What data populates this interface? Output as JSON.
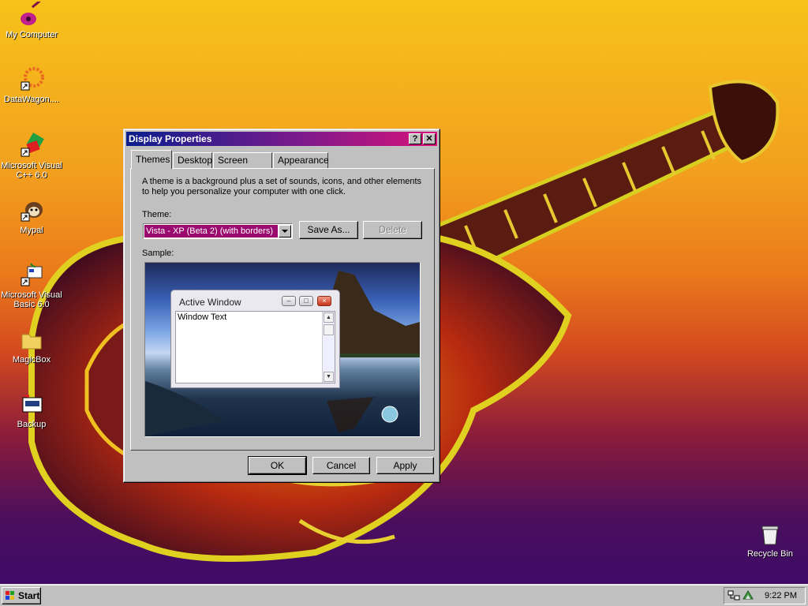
{
  "desktop": {
    "icons": [
      {
        "label": "My Computer",
        "icon": "guitar-icon"
      },
      {
        "label": "DataWagon....",
        "icon": "datawagon-shortcut-icon"
      },
      {
        "label": "Microsoft Visual C++ 6.0",
        "icon": "visual-cpp-shortcut-icon"
      },
      {
        "label": "Mypal",
        "icon": "mypal-shortcut-icon"
      },
      {
        "label": "Microsoft Visual Basic 6.0",
        "icon": "visual-basic-shortcut-icon"
      },
      {
        "label": "MagicBox",
        "icon": "folder-icon"
      },
      {
        "label": "Backup",
        "icon": "backup-icon"
      },
      {
        "label": "Recycle Bin",
        "icon": "recycle-bin-icon"
      }
    ]
  },
  "dialog": {
    "title": "Display Properties",
    "help_button": "?",
    "close_button": "✕",
    "tabs": [
      "Themes",
      "Desktop",
      "Screen Saver",
      "Appearance"
    ],
    "active_tab": "Themes",
    "description_line1": "A theme is a background plus a set of sounds, icons, and other elements",
    "description_line2": "to help you personalize your computer with one click.",
    "theme_label": "Theme:",
    "theme_value": "Vista - XP (Beta 2) (with borders)",
    "save_as_label": "Save As...",
    "delete_label": "Delete",
    "sample_label": "Sample:",
    "preview": {
      "window_title": "Active Window",
      "window_text": "Window Text"
    },
    "ok_label": "OK",
    "cancel_label": "Cancel",
    "apply_label": "Apply"
  },
  "taskbar": {
    "start_label": "Start",
    "clock": "9:22 PM"
  },
  "colors": {
    "title_gradient_start": "#0a1e8c",
    "title_gradient_end": "#d8127a",
    "selection": "#9b0a6e",
    "face": "#c0c0c0"
  }
}
